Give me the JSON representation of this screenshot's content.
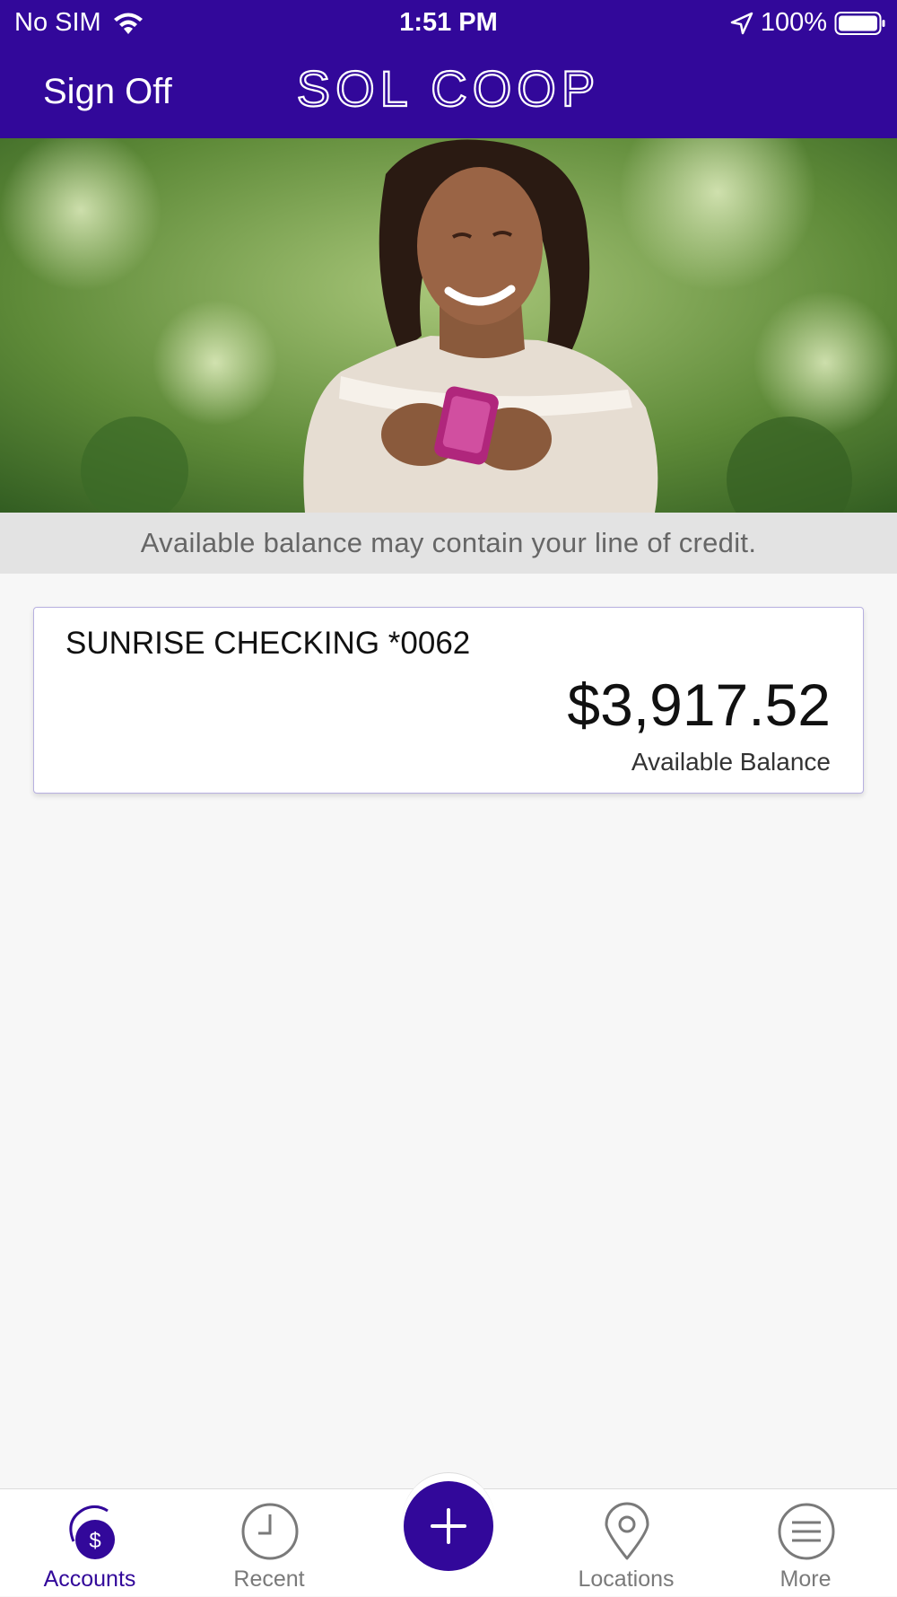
{
  "status_bar": {
    "carrier": "No SIM",
    "time": "1:51 PM",
    "battery": "100%",
    "icons": [
      "wifi-icon",
      "location-arrow-icon",
      "battery-icon"
    ]
  },
  "header": {
    "sign_off_label": "Sign Off",
    "brand": "SOL COOP"
  },
  "hero": {
    "image": "smiling-woman-with-phone-photo"
  },
  "notice": "Available balance may contain your line of credit.",
  "accounts": [
    {
      "name": "SUNRISE CHECKING *0062",
      "balance": "$3,917.52",
      "balance_label": "Available Balance"
    }
  ],
  "tab_bar": {
    "tabs": [
      {
        "label": "Accounts",
        "icon": "accounts-dollar-icon",
        "active": true
      },
      {
        "label": "Recent",
        "icon": "clock-icon",
        "active": false
      },
      {
        "label": "Locations",
        "icon": "map-pin-icon",
        "active": false
      },
      {
        "label": "More",
        "icon": "menu-icon",
        "active": false
      }
    ],
    "fab_icon": "plus-icon"
  },
  "colors": {
    "brand_purple": "#32089a",
    "background": "#f7f7f7",
    "notice_bg": "#e3e3e3",
    "card_border": "#b7b0e0",
    "inactive_tab": "#7a7a7a"
  }
}
